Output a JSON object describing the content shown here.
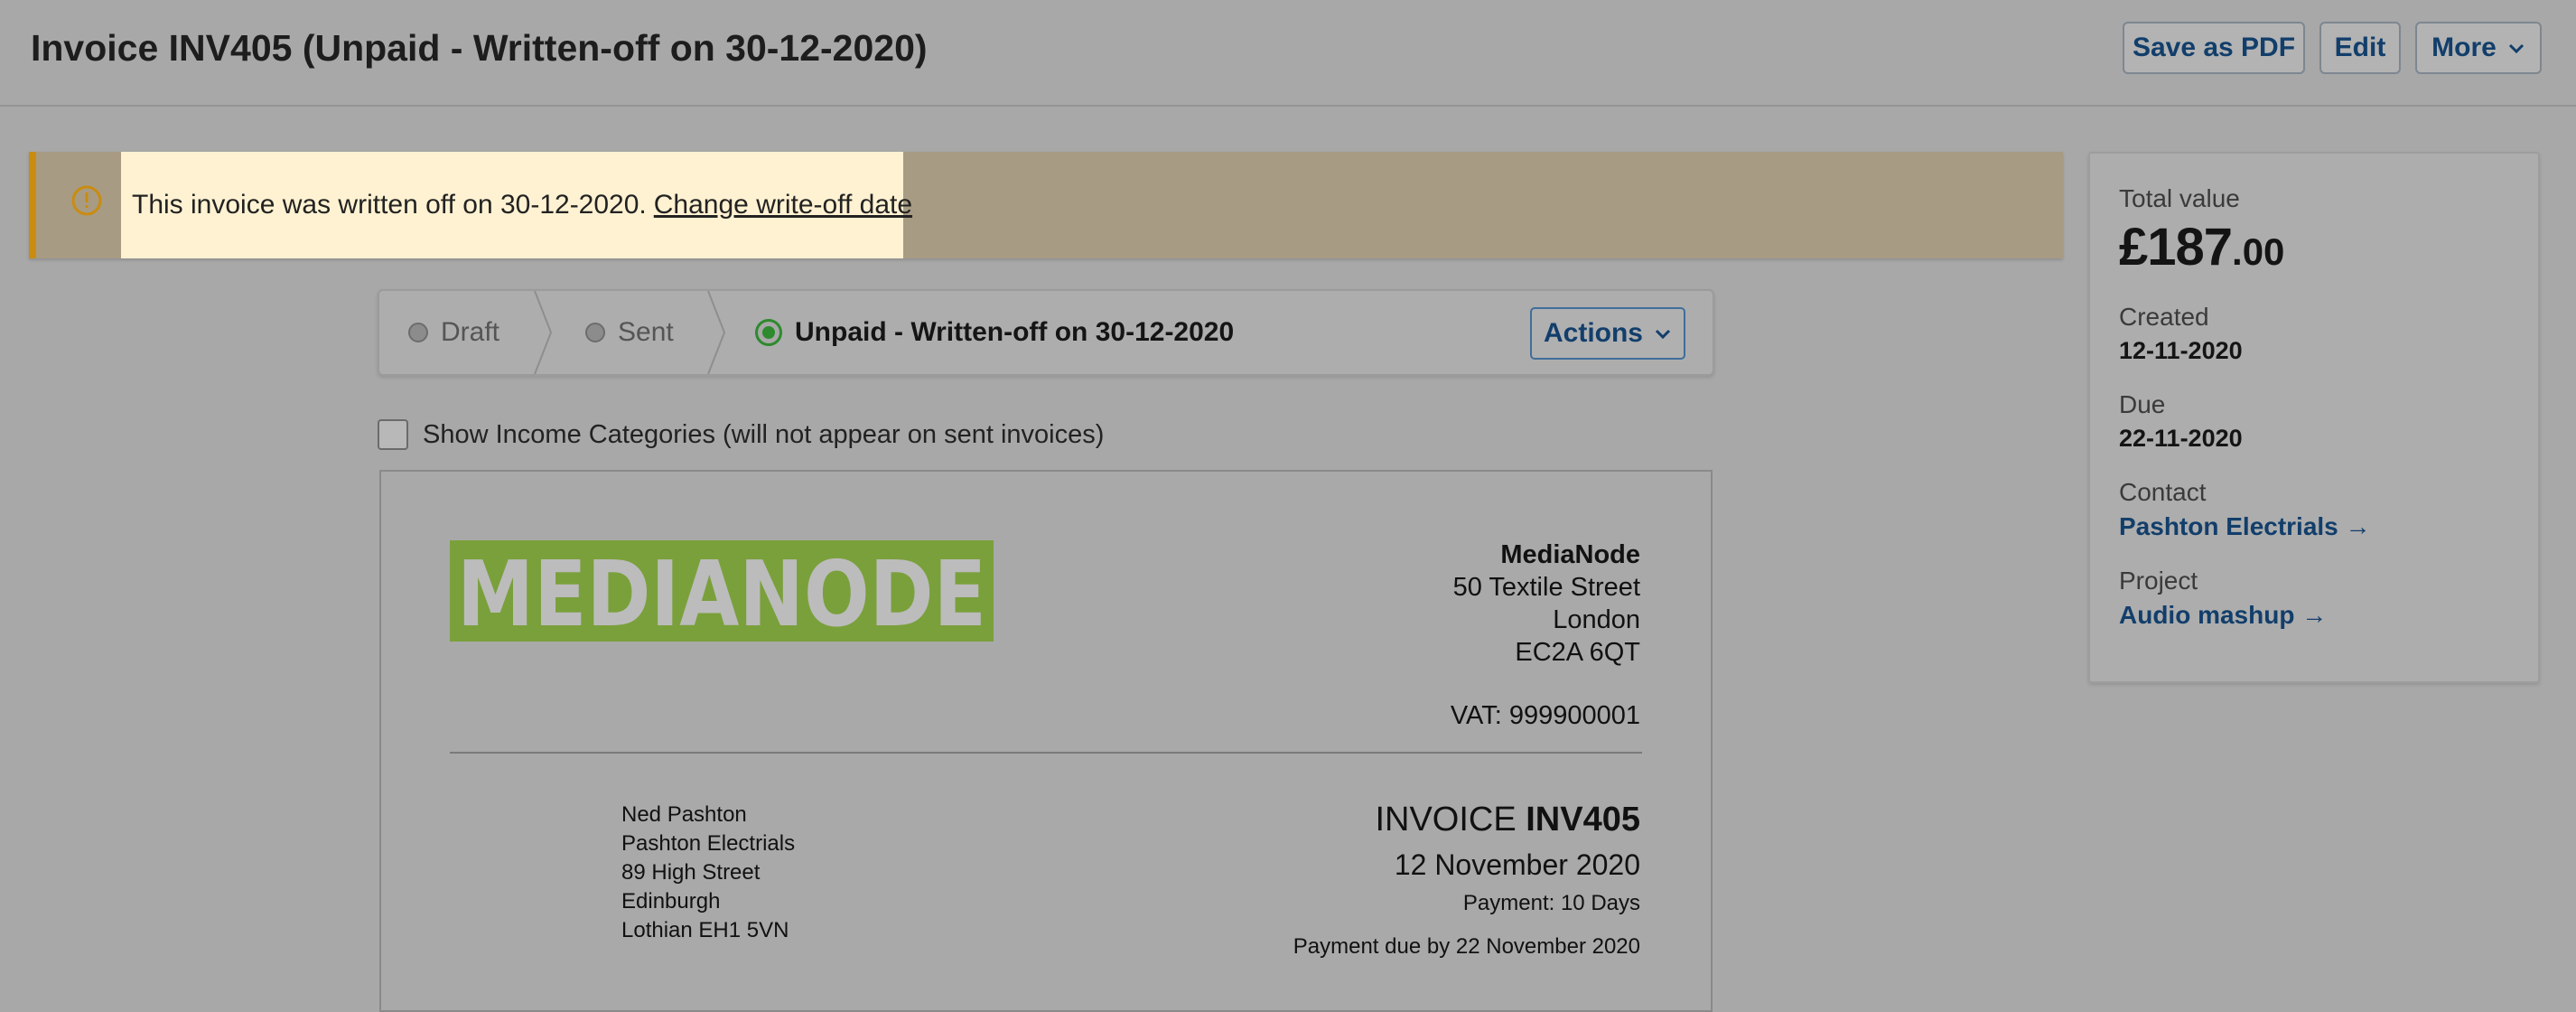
{
  "header": {
    "title": "Invoice INV405 (Unpaid - Written-off on 30-12-2020)",
    "save_pdf": "Save as PDF",
    "edit": "Edit",
    "more": "More"
  },
  "banner": {
    "message": "This invoice was written off on 30-12-2020.",
    "link": "Change write-off date"
  },
  "stepper": {
    "steps": [
      {
        "label": "Draft",
        "state": "done"
      },
      {
        "label": "Sent",
        "state": "done"
      },
      {
        "label": "Unpaid - Written-off on 30-12-2020",
        "state": "current"
      }
    ],
    "actions": "Actions"
  },
  "show_categories": {
    "label": "Show Income Categories (will not appear on sent invoices)",
    "checked": false
  },
  "invoice": {
    "logo_text": "MEDIANODE",
    "logo_color": "#7aa03b",
    "seller": {
      "name": "MediaNode",
      "address": [
        "50 Textile Street",
        "London",
        "EC2A 6QT"
      ],
      "vat": "VAT: 999900001"
    },
    "buyer": [
      "Ned Pashton",
      "Pashton Electrials",
      "89 High Street",
      "Edinburgh",
      "Lothian EH1 5VN"
    ],
    "title_prefix": "INVOICE",
    "number": "INV405",
    "date": "12 November 2020",
    "terms": "Payment: 10 Days",
    "due": "Payment due by 22 November 2020"
  },
  "summary": {
    "total_label": "Total value",
    "total_main": "£187",
    "total_pence": ".00",
    "created_label": "Created",
    "created": "12-11-2020",
    "due_label": "Due",
    "due": "22-11-2020",
    "contact_label": "Contact",
    "contact": "Pashton Electrials →",
    "project_label": "Project",
    "project": "Audio mashup →"
  },
  "colors": {
    "link": "#123e6b",
    "warning": "#c98c10",
    "success": "#2d8a2d",
    "banner_highlight": "#fff2d2"
  }
}
